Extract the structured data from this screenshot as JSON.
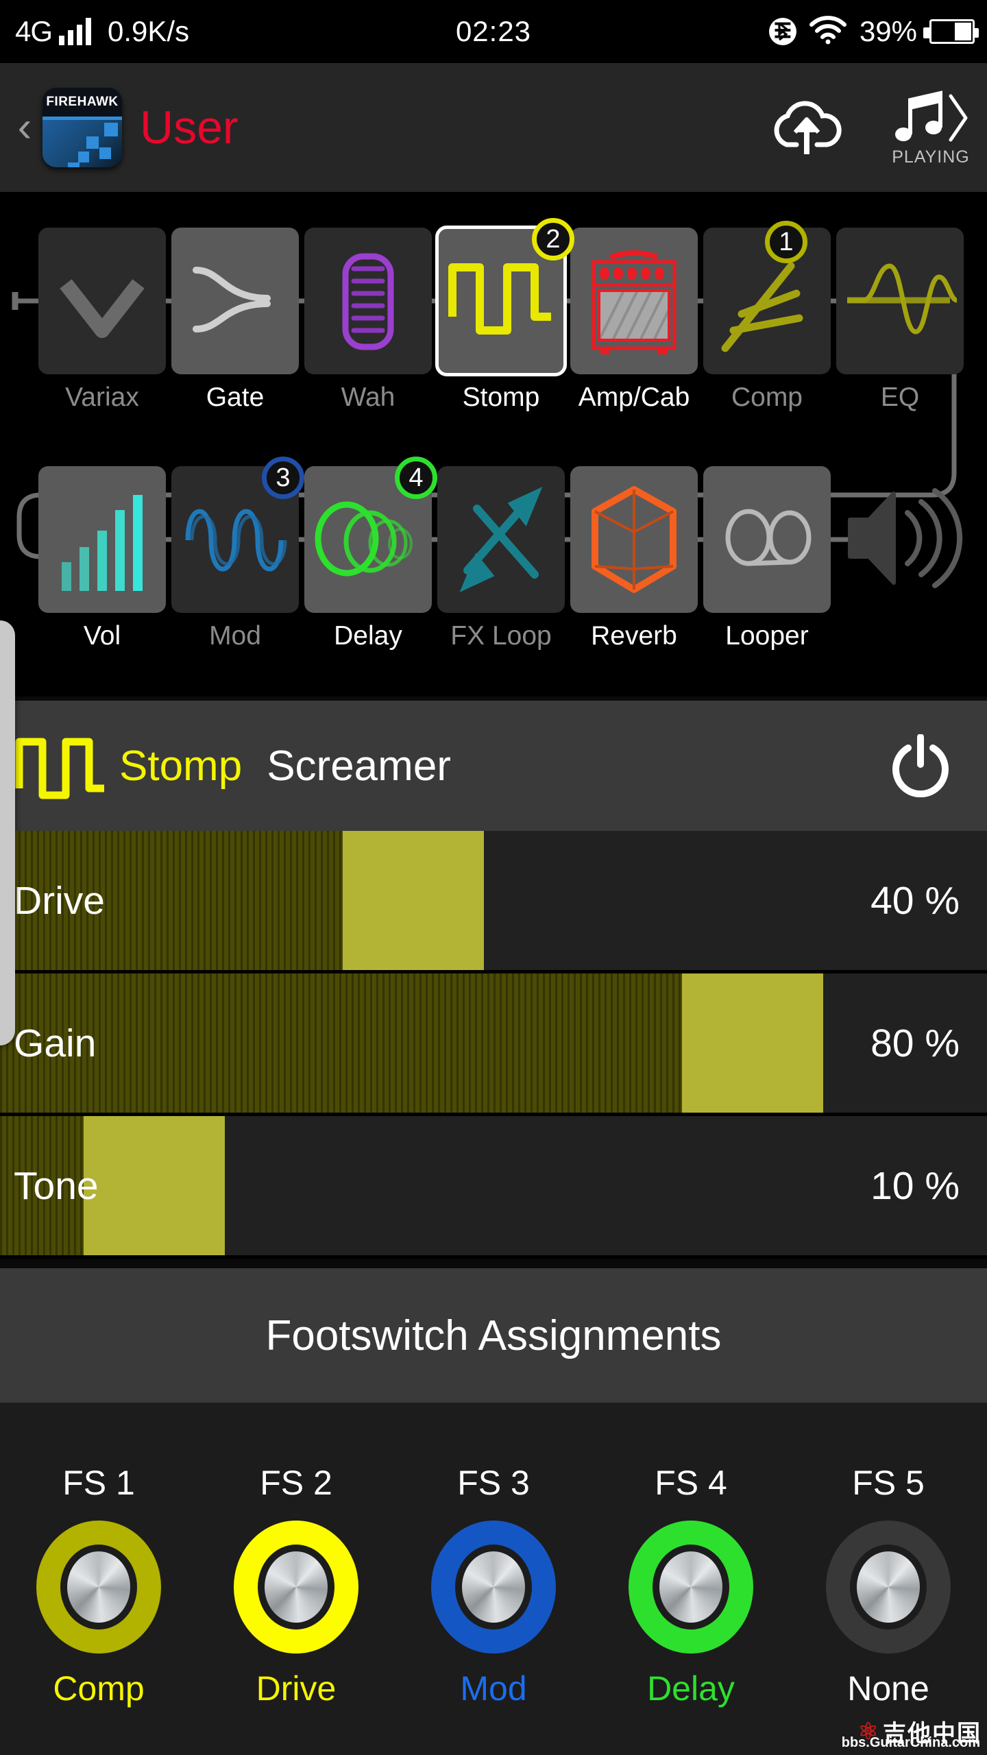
{
  "status_bar": {
    "network_type": "4G",
    "data_speed": "0.9K/s",
    "clock": "02:23",
    "battery_percent": "39%",
    "bluetooth_icon": "bluetooth-icon",
    "wifi_icon": "wifi-icon",
    "signal_icon": "signal-bars-icon",
    "battery_icon": "battery-icon"
  },
  "app_bar": {
    "back_label": "‹",
    "app_icon_text": "FIREHAWK",
    "title": "User",
    "title_color": "#e8072c",
    "cloud_icon": "cloud-upload-icon",
    "music_icon": "music-note-icon",
    "chevron_icon": "chevron-right-icon",
    "playing_label": "PLAYING"
  },
  "signal_chain": {
    "row1": [
      {
        "label": "Variax",
        "icon": "variax-icon",
        "state": "off",
        "badge": null
      },
      {
        "label": "Gate",
        "icon": "gate-icon",
        "state": "on",
        "badge": null
      },
      {
        "label": "Wah",
        "icon": "wah-icon",
        "state": "off",
        "badge": null
      },
      {
        "label": "Stomp",
        "icon": "stomp-icon",
        "state": "selected",
        "badge": "2",
        "badge_color": "#e8e800"
      },
      {
        "label": "Amp/Cab",
        "icon": "amp-cab-icon",
        "state": "on",
        "badge": null
      },
      {
        "label": "Comp",
        "icon": "comp-icon",
        "state": "off",
        "badge": "1",
        "badge_color": "#b2b200"
      },
      {
        "label": "EQ",
        "icon": "eq-icon",
        "state": "off",
        "badge": null
      }
    ],
    "row2": [
      {
        "label": "Vol",
        "icon": "volume-bars-icon",
        "state": "on",
        "badge": null
      },
      {
        "label": "Mod",
        "icon": "mod-wave-icon",
        "state": "off",
        "badge": "3",
        "badge_color": "#1f4fa8"
      },
      {
        "label": "Delay",
        "icon": "delay-circles-icon",
        "state": "on",
        "badge": "4",
        "badge_color": "#2ee02e"
      },
      {
        "label": "FX Loop",
        "icon": "fx-loop-icon",
        "state": "off",
        "badge": null
      },
      {
        "label": "Reverb",
        "icon": "reverb-cube-icon",
        "state": "on",
        "badge": null
      },
      {
        "label": "Looper",
        "icon": "looper-reel-icon",
        "state": "on",
        "badge": null
      }
    ],
    "output_icon": "speaker-output-icon"
  },
  "detail": {
    "block_icon": "stomp-icon",
    "block_name": "Stomp",
    "block_name_color": "#f5f500",
    "model_name": "Screamer",
    "power_icon": "power-icon",
    "parameters": [
      {
        "name": "Drive",
        "value": 40,
        "display": "40 %"
      },
      {
        "name": "Gain",
        "value": 80,
        "display": "80 %"
      },
      {
        "name": "Tone",
        "value": 10,
        "display": "10 %"
      }
    ]
  },
  "footswitches": {
    "section_title": "Footswitch Assignments",
    "items": [
      {
        "number": "FS 1",
        "assignment": "Comp",
        "ring_color": "#b2b200",
        "label_color": "#f5f500"
      },
      {
        "number": "FS 2",
        "assignment": "Drive",
        "ring_color": "#fdfd00",
        "label_color": "#f5f500"
      },
      {
        "number": "FS 3",
        "assignment": "Mod",
        "ring_color": "#1456c4",
        "label_color": "#1a6ef0"
      },
      {
        "number": "FS 4",
        "assignment": "Delay",
        "ring_color": "#2ee02e",
        "label_color": "#2ee02e"
      },
      {
        "number": "FS 5",
        "assignment": "None",
        "ring_color": "#383838",
        "label_color": "#ffffff"
      }
    ]
  },
  "watermark": {
    "brand_cn": "吉他中国",
    "url": "bbs.GuitarChina.com"
  }
}
